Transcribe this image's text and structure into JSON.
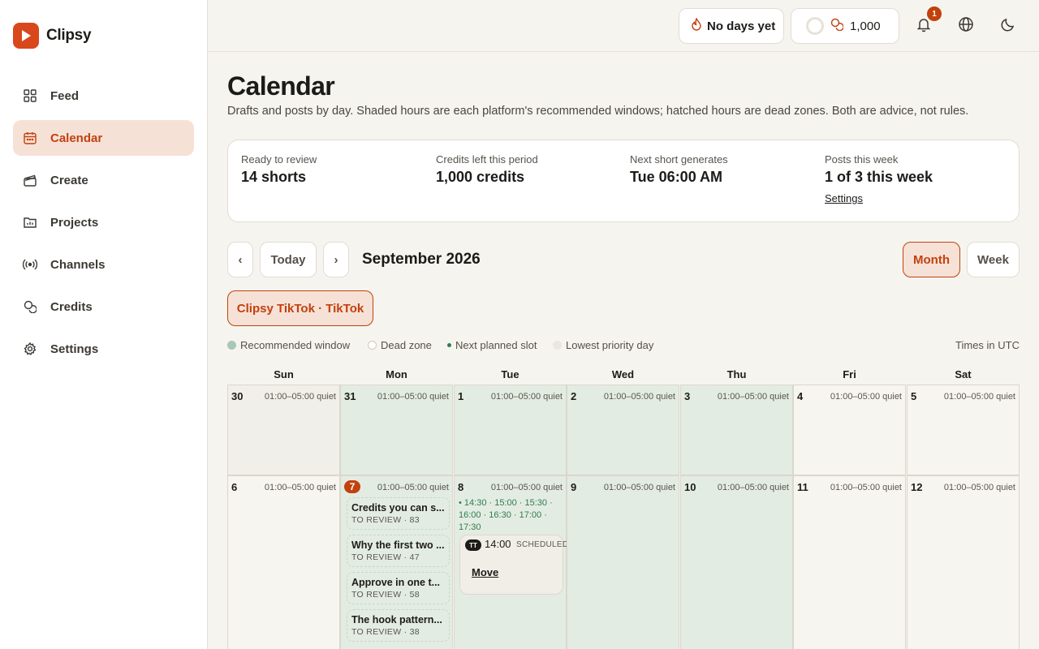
{
  "app": {
    "name": "Clipsy"
  },
  "sidebar": {
    "items": [
      {
        "label": "Feed",
        "icon": "grid-icon"
      },
      {
        "label": "Calendar",
        "icon": "calendar-icon",
        "active": true
      },
      {
        "label": "Create",
        "icon": "clapper-icon"
      },
      {
        "label": "Projects",
        "icon": "folder-icon"
      },
      {
        "label": "Channels",
        "icon": "broadcast-icon"
      },
      {
        "label": "Credits",
        "icon": "coins-icon"
      },
      {
        "label": "Settings",
        "icon": "gear-icon"
      }
    ]
  },
  "topbar": {
    "streak_label": "No days yet",
    "credits_value": "1,000",
    "notifications_count": "1"
  },
  "page": {
    "title": "Calendar",
    "subtitle": "Drafts and posts by day. Shaded hours are each platform's recommended windows; hatched hours are dead zones. Both are advice, not rules."
  },
  "stats": [
    {
      "label": "Ready to review",
      "value": "14 shorts"
    },
    {
      "label": "Credits left this period",
      "value": "1,000 credits"
    },
    {
      "label": "Next short generates",
      "value": "Tue 06:00 AM"
    },
    {
      "label": "Posts this week",
      "value": "1 of 3 this week",
      "link": "Settings"
    }
  ],
  "controls": {
    "prev": "‹",
    "today": "Today",
    "next": "›",
    "month_label": "September 2026",
    "view_month": "Month",
    "view_week": "Week"
  },
  "channel_filter": "Clipsy TikTok · TikTok",
  "legend": {
    "recommended": "Recommended window",
    "dead_zone": "Dead zone",
    "next_slot": "Next planned slot",
    "lowest_priority": "Lowest priority day",
    "timezone": "Times in UTC"
  },
  "colors": {
    "accent": "#c2410c",
    "recommended_bg": "#e3ece2",
    "slot_green": "#2e7d4f"
  },
  "calendar": {
    "weekdays": [
      "Sun",
      "Mon",
      "Tue",
      "Wed",
      "Thu",
      "Fri",
      "Sat"
    ],
    "quiet_label": "01:00–05:00 quiet",
    "week1": [
      {
        "day": "30",
        "kind": "out"
      },
      {
        "day": "31",
        "kind": "rec"
      },
      {
        "day": "1",
        "kind": "rec"
      },
      {
        "day": "2",
        "kind": "rec"
      },
      {
        "day": "3",
        "kind": "rec"
      },
      {
        "day": "4",
        "kind": "plain"
      },
      {
        "day": "5",
        "kind": "plain"
      }
    ],
    "week2": [
      {
        "day": "6",
        "kind": "plain"
      },
      {
        "day": "7",
        "kind": "rec",
        "today": true
      },
      {
        "day": "8",
        "kind": "rec"
      },
      {
        "day": "9",
        "kind": "rec"
      },
      {
        "day": "10",
        "kind": "rec"
      },
      {
        "day": "11",
        "kind": "plain"
      },
      {
        "day": "12",
        "kind": "plain"
      }
    ],
    "mon7_cards": [
      {
        "title": "Credits you can s...",
        "meta": "TO REVIEW · 83"
      },
      {
        "title": "Why the first two ...",
        "meta": "TO REVIEW · 47"
      },
      {
        "title": "Approve in one t...",
        "meta": "TO REVIEW · 58"
      },
      {
        "title": "The hook pattern...",
        "meta": "TO REVIEW · 38"
      }
    ],
    "tue8_slots": "• 14:30 · 15:00 · 15:30 · 16:00 · 16:30 · 17:00 · 17:30",
    "tue8_scheduled": {
      "platform": "TT",
      "time": "14:00",
      "status": "SCHEDULED",
      "action": "Move"
    }
  }
}
